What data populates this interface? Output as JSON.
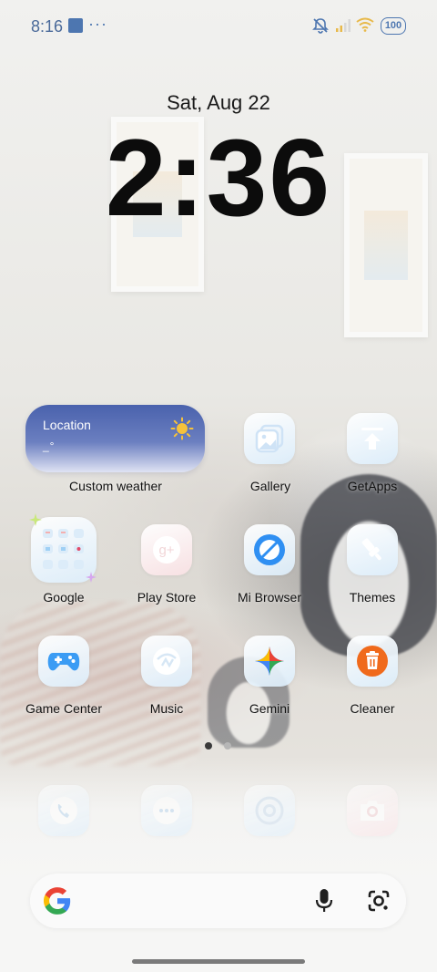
{
  "status_bar": {
    "time": "8:16",
    "overflow": "···",
    "battery": "100",
    "icons": [
      "app-notification-icon",
      "mute-icon",
      "signal-icon",
      "wifi-icon",
      "battery-icon"
    ]
  },
  "lock": {
    "date": "Sat, Aug 22",
    "time": "2:36"
  },
  "weather_widget": {
    "location": "Location",
    "temperature": "_°",
    "label": "Custom weather"
  },
  "apps": [
    {
      "label": "Gallery",
      "icon": "gallery-icon"
    },
    {
      "label": "GetApps",
      "icon": "getapps-icon"
    },
    {
      "label": "Google",
      "icon": "google-folder-icon"
    },
    {
      "label": "Play Store",
      "icon": "play-store-icon"
    },
    {
      "label": "Mi Browser",
      "icon": "mi-browser-icon"
    },
    {
      "label": "Themes",
      "icon": "themes-icon"
    },
    {
      "label": "Game Center",
      "icon": "game-center-icon"
    },
    {
      "label": "Music",
      "icon": "music-icon"
    },
    {
      "label": "Gemini",
      "icon": "gemini-icon"
    },
    {
      "label": "Cleaner",
      "icon": "cleaner-icon"
    }
  ],
  "dock": [
    "phone-icon",
    "messages-icon",
    "chrome-icon",
    "camera-icon"
  ],
  "pager": {
    "pages": 2,
    "active": 1
  },
  "colors": {
    "status_blue": "#4d76b0",
    "weather_top": "#4a62ad",
    "cleaner_orange": "#f06a1c",
    "browser_blue": "#2f8ff2"
  }
}
